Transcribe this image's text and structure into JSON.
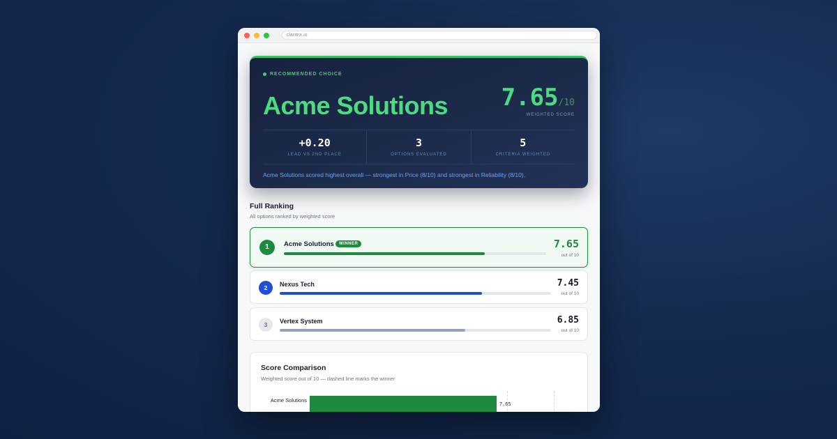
{
  "browser": {
    "url": "claritrix.io",
    "dot_colors": [
      "#ff5f57",
      "#febc2e",
      "#28c840"
    ]
  },
  "hero": {
    "label": "RECOMMENDED CHOICE",
    "name": "Acme Solutions",
    "score": "7.65",
    "score_denominator": "/10",
    "score_label": "WEIGHTED SCORE",
    "stats": [
      {
        "value": "+0.20",
        "label": "LEAD VS 2ND PLACE"
      },
      {
        "value": "3",
        "label": "OPTIONS EVALUATED"
      },
      {
        "value": "5",
        "label": "CRITERIA WEIGHTED"
      }
    ],
    "summary": "Acme Solutions scored highest overall — strongest in Price (8/10) and strongest in Reliability (8/10)."
  },
  "ranking": {
    "title": "Full Ranking",
    "subtitle": "All options ranked by weighted score",
    "items": [
      {
        "rank": "1",
        "name": "Acme Solutions",
        "tag": "WINNER",
        "score": "7.65",
        "out_of": "out of 10",
        "fraction": 0.765,
        "color": "#1d8a3f"
      },
      {
        "rank": "2",
        "name": "Nexus Tech",
        "score": "7.45",
        "out_of": "out of 10",
        "fraction": 0.745,
        "color": "#1f4fd8"
      },
      {
        "rank": "3",
        "name": "Vertex System",
        "score": "6.85",
        "out_of": "out of 10",
        "fraction": 0.685,
        "color": "#94a3b8"
      }
    ]
  },
  "comparison": {
    "title": "Score Comparison",
    "subtitle": "Weighted score out of 10 — dashed line marks the winner",
    "chart_data": {
      "type": "bar",
      "categories": [
        "Acme Solutions"
      ],
      "values": [
        7.65
      ],
      "value_labels": [
        "7.65"
      ],
      "xlim": [
        0,
        10
      ]
    }
  }
}
